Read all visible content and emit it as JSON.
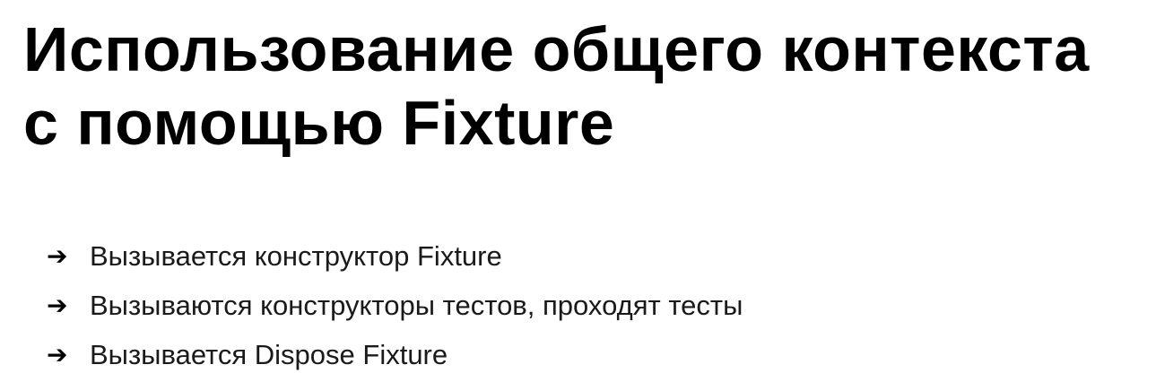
{
  "slide": {
    "title_lines": [
      "Использование общего контекста",
      "с помощью Fixture"
    ],
    "bullet_icon": "arrow-right-icon",
    "bullets": [
      {
        "arrow": "➔",
        "text": "Вызывается конструктор Fixture"
      },
      {
        "arrow": "➔",
        "text": "Вызываются конструкторы тестов, проходят тесты"
      },
      {
        "arrow": "➔",
        "text": "Вызывается Dispose Fixture"
      }
    ]
  }
}
